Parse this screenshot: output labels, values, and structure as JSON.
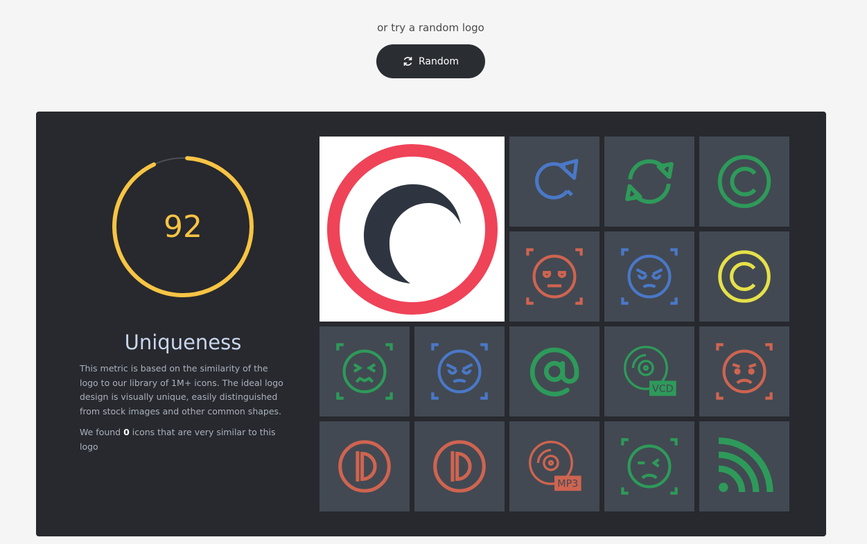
{
  "header": {
    "hint": "or try a random logo",
    "random_label": "Random"
  },
  "metric": {
    "score": "92",
    "score_fraction": 0.92,
    "title": "Uniqueness",
    "description": "This metric is based on the similarity of the logo to our library of 1M+ icons. The ideal logo design is visually unique, easily distinguished from stock images and other common shapes.",
    "found_prefix": "We found ",
    "found_count": "0",
    "found_suffix": " icons that are very similar to this logo"
  },
  "colors": {
    "gauge": "#f8c444",
    "track": "#4a4f57",
    "blue": "#4a78c8",
    "green": "#2e9a5a",
    "red": "#cf6450",
    "yellow": "#e6e04a",
    "logo_ring": "#ef4358",
    "logo_moon": "#2f3540"
  },
  "tiles": [
    {
      "icon": "refresh-arrow-icon",
      "color": "#4a78c8"
    },
    {
      "icon": "sync-arrows-icon",
      "color": "#2e9a5a"
    },
    {
      "icon": "copyright-icon",
      "color": "#2e9a5a"
    },
    {
      "icon": "sleepy-face-icon",
      "color": "#cf6450"
    },
    {
      "icon": "angry-face-icon",
      "color": "#4a78c8"
    },
    {
      "icon": "copyright-icon",
      "color": "#e6e04a"
    },
    {
      "icon": "squinting-face-icon",
      "color": "#2e9a5a"
    },
    {
      "icon": "angry-face-icon",
      "color": "#4a78c8"
    },
    {
      "icon": "at-sign-icon",
      "color": "#2e9a5a"
    },
    {
      "icon": "vcd-disc-icon",
      "color": "#2e9a5a",
      "label": "VCD"
    },
    {
      "icon": "sad-face-icon",
      "color": "#cf6450"
    },
    {
      "icon": "d-circle-icon",
      "color": "#cf6450"
    },
    {
      "icon": "d-circle-icon",
      "color": "#cf6450"
    },
    {
      "icon": "mp3-disc-icon",
      "color": "#cf6450",
      "label": "MP3"
    },
    {
      "icon": "winking-sad-face-icon",
      "color": "#2e9a5a"
    },
    {
      "icon": "rss-feed-icon",
      "color": "#2e9a5a"
    }
  ]
}
